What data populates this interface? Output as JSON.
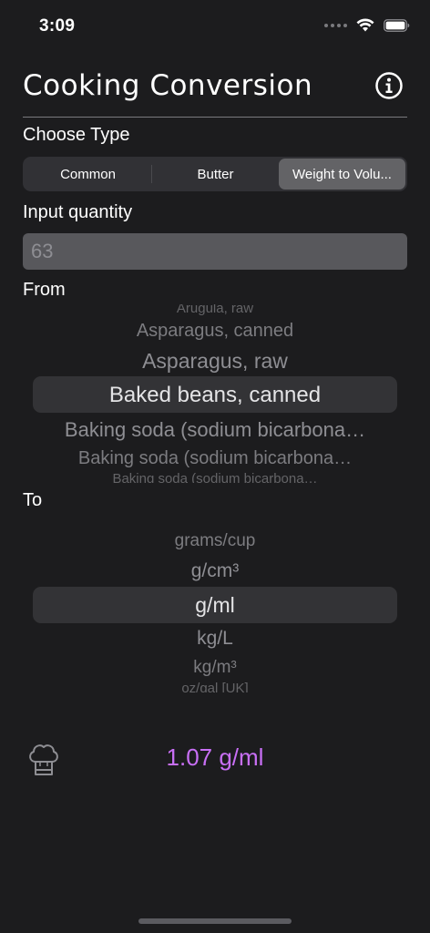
{
  "status_bar": {
    "time": "3:09"
  },
  "header": {
    "title": "Cooking Conversion",
    "info_icon": "info-circle-icon"
  },
  "type_section": {
    "label": "Choose Type",
    "segments": [
      "Common",
      "Butter",
      "Weight to Volu..."
    ],
    "selected_index": 2
  },
  "quantity_section": {
    "label": "Input quantity",
    "placeholder": "63",
    "value": ""
  },
  "from_section": {
    "label": "From",
    "items": [
      "Arugula, raw",
      "Asparagus, canned",
      "Asparagus, raw",
      "Baked beans, canned",
      "Baking soda (sodium bicarbona…",
      "Baking soda (sodium bicarbona…",
      "Baking soda (sodium bicarbona…"
    ],
    "selected_index": 3
  },
  "to_section": {
    "label": "To",
    "items": [
      "grams/cup",
      "g/cm³",
      "g/ml",
      "kg/L",
      "kg/m³",
      "oz/gal [UK]"
    ],
    "selected_index": 2
  },
  "result": {
    "icon": "chef-hat-icon",
    "text": "1.07 g/ml",
    "color": "#c86ff5"
  }
}
